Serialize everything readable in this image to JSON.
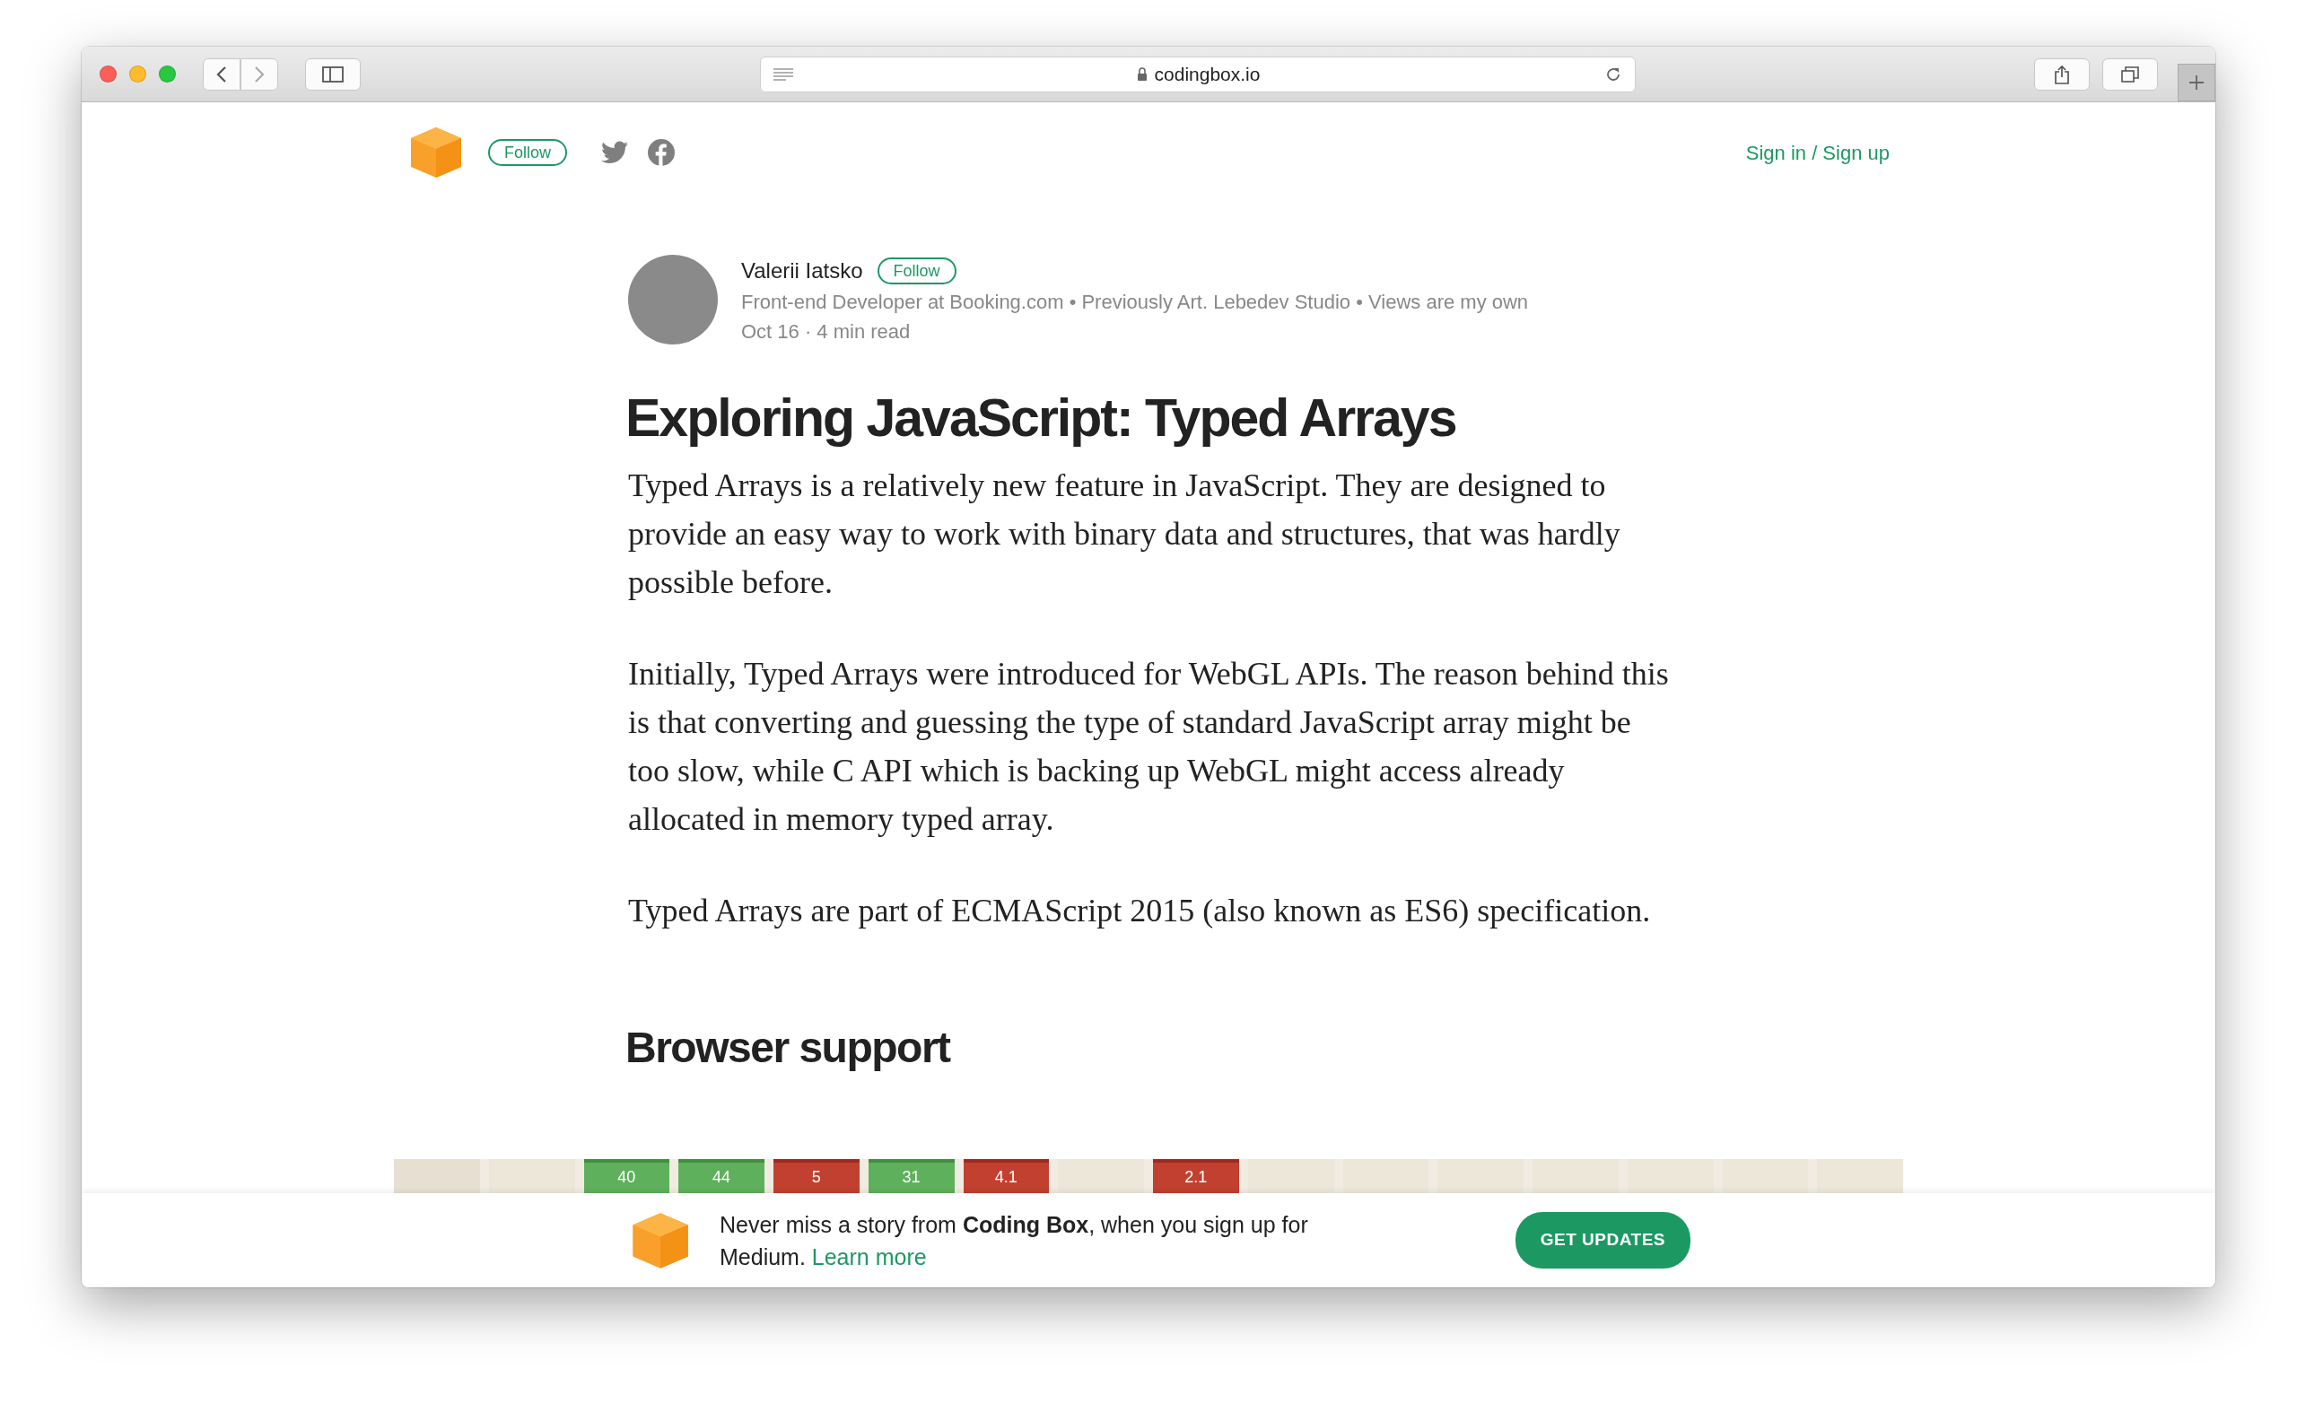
{
  "browser": {
    "url": "codingbox.io"
  },
  "header": {
    "follow": "Follow",
    "auth": "Sign in / Sign up"
  },
  "author": {
    "name": "Valerii Iatsko",
    "follow": "Follow",
    "bio": "Front-end Developer at Booking.com • Previously Art. Lebedev Studio • Views are my own",
    "meta": "Oct 16 · 4 min read"
  },
  "article": {
    "title": "Exploring JavaScript: Typed Arrays",
    "paragraphs": [
      "Typed Arrays is a relatively new feature in JavaScript. They are designed to provide an easy way to work with binary data and structures, that was hardly possible before.",
      "Initially, Typed Arrays were introduced for WebGL APIs. The reason behind this is that converting and guessing the type of standard JavaScript array might be too slow, while C API which is backing up WebGL might access already allocated in memory typed array.",
      "Typed Arrays are part of ECMAScript 2015 (also known as ES6) specification."
    ],
    "heading": "Browser support",
    "support_cells": [
      {
        "kind": "header"
      },
      {
        "kind": "blank"
      },
      {
        "kind": "yes",
        "label": "40"
      },
      {
        "kind": "yes",
        "label": "44"
      },
      {
        "kind": "no",
        "label": "5"
      },
      {
        "kind": "yes",
        "label": "31"
      },
      {
        "kind": "no",
        "label": "4.1"
      },
      {
        "kind": "blank"
      },
      {
        "kind": "no",
        "label": "2.1"
      },
      {
        "kind": "blank"
      },
      {
        "kind": "blank"
      },
      {
        "kind": "blank"
      },
      {
        "kind": "blank"
      },
      {
        "kind": "blank"
      },
      {
        "kind": "blank"
      },
      {
        "kind": "blank"
      }
    ]
  },
  "banner": {
    "text": "Never miss a story from **Coding Box**, when you sign up for Medium.",
    "link": "Learn more",
    "button": "GET UPDATES"
  }
}
